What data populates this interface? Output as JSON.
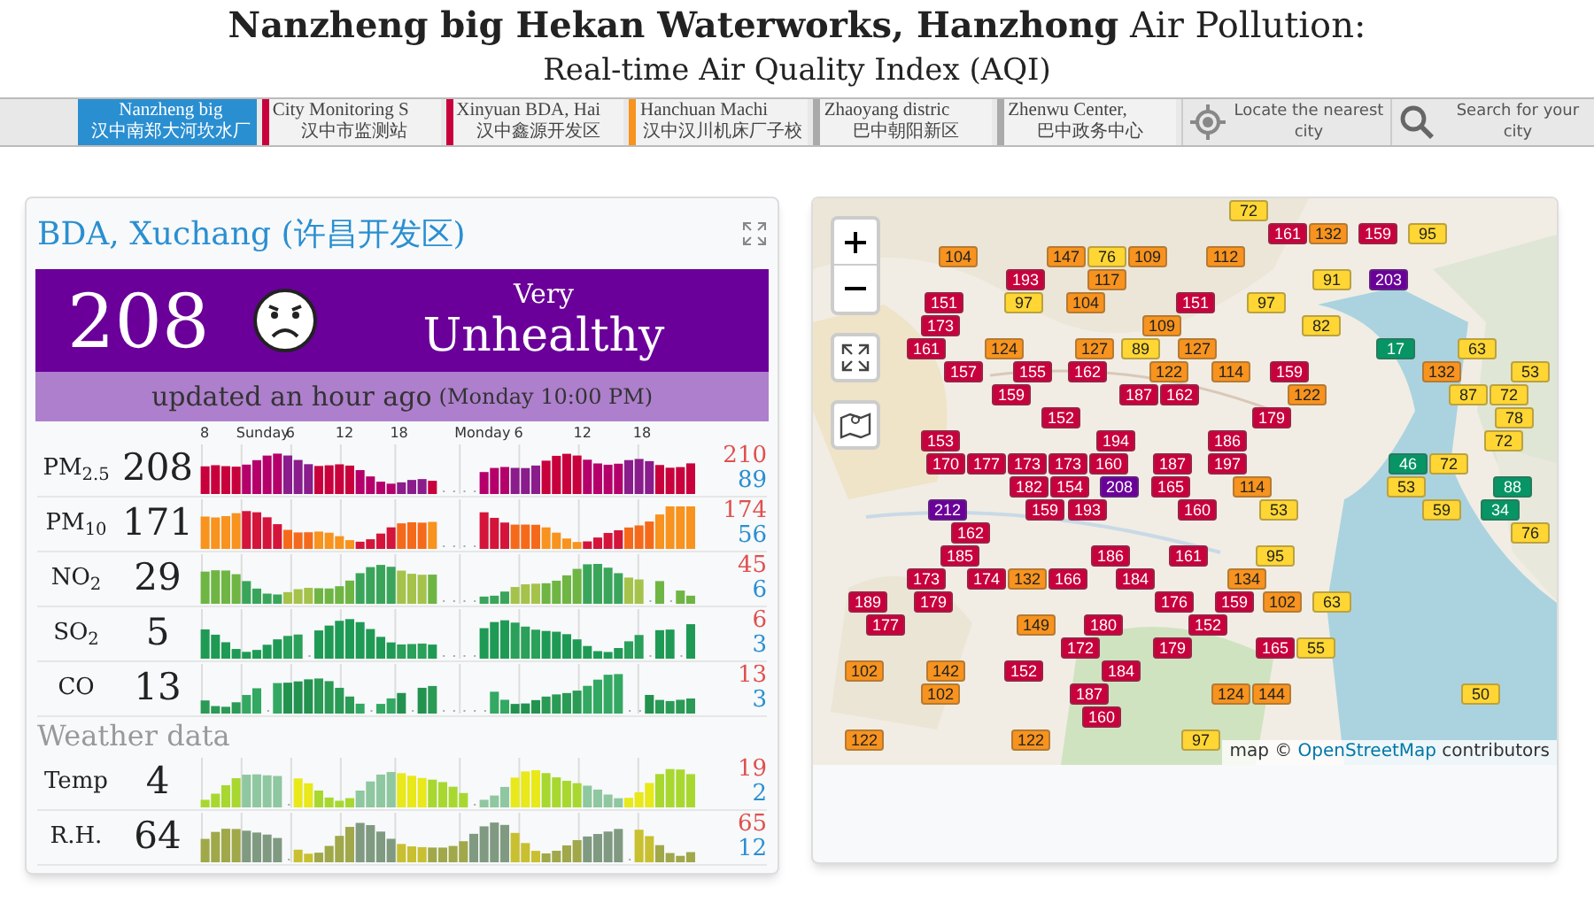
{
  "header": {
    "title": "**Nanzheng big Hekan Waterworks, Hanzhong** Air Pollution:",
    "subtitle": "Real-time Air Quality Index (AQI)"
  },
  "nav": {
    "tabs": [
      {
        "label": "Nanzheng big",
        "sublabel": "汉中南郑大河坎水厂",
        "color": "#2a8fd1",
        "selected": true
      },
      {
        "label": "City Monitoring S",
        "sublabel": "汉中市监测站",
        "color": "#c8003c",
        "selected": false
      },
      {
        "label": "Xinyuan BDA, Hai",
        "sublabel": "汉中鑫源开发区",
        "color": "#c8003c",
        "selected": false
      },
      {
        "label": "Hanchuan Machi",
        "sublabel": "汉中汉川机床厂子校",
        "color": "#f7931e",
        "selected": false
      },
      {
        "label": "Zhaoyang distric",
        "sublabel": "巴中朝阳新区",
        "color": "#aaaaaa",
        "selected": false
      },
      {
        "label": "Zhenwu Center,",
        "sublabel": "巴中政务中心",
        "color": "#aaaaaa",
        "selected": false
      }
    ],
    "locate": "Locate the nearest city",
    "search": "Search for your city"
  },
  "station": {
    "title": "BDA, Xuchang (许昌开发区)",
    "aqi": "208",
    "level_top": "Very",
    "level": "Unhealthy",
    "updated": "updated an hour ago",
    "updated_time": "(Monday 10:00 PM)",
    "axis_labels": [
      "8",
      "Sunday",
      "6",
      "12",
      "18",
      "Monday",
      "6",
      "12",
      "18"
    ],
    "pollutants": [
      {
        "name": "PM$_{2.5}$",
        "value": "208",
        "max": "210",
        "min": "89"
      },
      {
        "name": "PM$_{10}$",
        "value": "171",
        "max": "174",
        "min": "56"
      },
      {
        "name": "NO$_{2}$",
        "value": "29",
        "max": "45",
        "min": "6"
      },
      {
        "name": "SO$_{2}$",
        "value": "5",
        "max": "6",
        "min": "3"
      },
      {
        "name": "CO",
        "value": "13",
        "max": "13",
        "min": "3"
      }
    ],
    "weather_heading": "Weather data",
    "weather": [
      {
        "name": "Temp",
        "value": "4",
        "max": "19",
        "min": "2"
      },
      {
        "name": "R.H.",
        "value": "64",
        "max": "65",
        "min": "12"
      }
    ]
  },
  "map": {
    "attribution_prefix": "map ©",
    "attribution_link": "OpenStreetMap",
    "attribution_suffix": "contributors",
    "markers": [
      {
        "value": "72",
        "color": "#ffd633"
      },
      {
        "value": "161",
        "color": "#c8003c"
      },
      {
        "value": "132",
        "color": "#f7931e"
      },
      {
        "value": "159",
        "color": "#c8003c"
      },
      {
        "value": "95",
        "color": "#ffd633"
      },
      {
        "value": "104",
        "color": "#f7931e"
      },
      {
        "value": "147",
        "color": "#f7931e"
      },
      {
        "value": "76",
        "color": "#ffd633"
      },
      {
        "value": "109",
        "color": "#f7931e"
      },
      {
        "value": "112",
        "color": "#f7931e"
      },
      {
        "value": "193",
        "color": "#c8003c"
      },
      {
        "value": "117",
        "color": "#f7931e"
      },
      {
        "value": "91",
        "color": "#ffd633"
      },
      {
        "value": "203",
        "color": "#6a0099"
      },
      {
        "value": "151",
        "color": "#c8003c"
      },
      {
        "value": "97",
        "color": "#ffd633"
      },
      {
        "value": "104",
        "color": "#f7931e"
      },
      {
        "value": "151",
        "color": "#c8003c"
      },
      {
        "value": "97",
        "color": "#ffd633"
      },
      {
        "value": "173",
        "color": "#c8003c"
      },
      {
        "value": "109",
        "color": "#f7931e"
      },
      {
        "value": "82",
        "color": "#ffd633"
      },
      {
        "value": "161",
        "color": "#c8003c"
      },
      {
        "value": "124",
        "color": "#f7931e"
      },
      {
        "value": "127",
        "color": "#f7931e"
      },
      {
        "value": "89",
        "color": "#ffd633"
      },
      {
        "value": "127",
        "color": "#f7931e"
      },
      {
        "value": "17",
        "color": "#079565"
      },
      {
        "value": "63",
        "color": "#ffd633"
      },
      {
        "value": "157",
        "color": "#c8003c"
      },
      {
        "value": "155",
        "color": "#c8003c"
      },
      {
        "value": "162",
        "color": "#c8003c"
      },
      {
        "value": "122",
        "color": "#f7931e"
      },
      {
        "value": "114",
        "color": "#f7931e"
      },
      {
        "value": "159",
        "color": "#c8003c"
      },
      {
        "value": "132",
        "color": "#f7931e"
      },
      {
        "value": "53",
        "color": "#ffd633"
      },
      {
        "value": "159",
        "color": "#c8003c"
      },
      {
        "value": "187",
        "color": "#c8003c"
      },
      {
        "value": "162",
        "color": "#c8003c"
      },
      {
        "value": "122",
        "color": "#f7931e"
      },
      {
        "value": "87",
        "color": "#ffd633"
      },
      {
        "value": "72",
        "color": "#ffd633"
      },
      {
        "value": "152",
        "color": "#c8003c"
      },
      {
        "value": "179",
        "color": "#c8003c"
      },
      {
        "value": "78",
        "color": "#ffd633"
      },
      {
        "value": "153",
        "color": "#c8003c"
      },
      {
        "value": "194",
        "color": "#c8003c"
      },
      {
        "value": "186",
        "color": "#c8003c"
      },
      {
        "value": "72",
        "color": "#ffd633"
      },
      {
        "value": "170",
        "color": "#c8003c"
      },
      {
        "value": "177",
        "color": "#c8003c"
      },
      {
        "value": "173",
        "color": "#c8003c"
      },
      {
        "value": "173",
        "color": "#c8003c"
      },
      {
        "value": "160",
        "color": "#c8003c"
      },
      {
        "value": "187",
        "color": "#c8003c"
      },
      {
        "value": "197",
        "color": "#c8003c"
      },
      {
        "value": "46",
        "color": "#079565"
      },
      {
        "value": "72",
        "color": "#ffd633"
      },
      {
        "value": "182",
        "color": "#c8003c"
      },
      {
        "value": "154",
        "color": "#c8003c"
      },
      {
        "value": "208",
        "color": "#6a0099"
      },
      {
        "value": "165",
        "color": "#c8003c"
      },
      {
        "value": "114",
        "color": "#f7931e"
      },
      {
        "value": "53",
        "color": "#ffd633"
      },
      {
        "value": "88",
        "color": "#079565"
      },
      {
        "value": "212",
        "color": "#6a0099"
      },
      {
        "value": "159",
        "color": "#c8003c"
      },
      {
        "value": "193",
        "color": "#c8003c"
      },
      {
        "value": "160",
        "color": "#c8003c"
      },
      {
        "value": "53",
        "color": "#ffd633"
      },
      {
        "value": "59",
        "color": "#ffd633"
      },
      {
        "value": "34",
        "color": "#079565"
      },
      {
        "value": "162",
        "color": "#c8003c"
      },
      {
        "value": "76",
        "color": "#ffd633"
      },
      {
        "value": "185",
        "color": "#c8003c"
      },
      {
        "value": "186",
        "color": "#c8003c"
      },
      {
        "value": "161",
        "color": "#c8003c"
      },
      {
        "value": "95",
        "color": "#ffd633"
      },
      {
        "value": "173",
        "color": "#c8003c"
      },
      {
        "value": "174",
        "color": "#c8003c"
      },
      {
        "value": "132",
        "color": "#f7931e"
      },
      {
        "value": "166",
        "color": "#c8003c"
      },
      {
        "value": "184",
        "color": "#c8003c"
      },
      {
        "value": "134",
        "color": "#f7931e"
      },
      {
        "value": "189",
        "color": "#c8003c"
      },
      {
        "value": "179",
        "color": "#c8003c"
      },
      {
        "value": "176",
        "color": "#c8003c"
      },
      {
        "value": "159",
        "color": "#c8003c"
      },
      {
        "value": "102",
        "color": "#f7931e"
      },
      {
        "value": "63",
        "color": "#ffd633"
      },
      {
        "value": "177",
        "color": "#c8003c"
      },
      {
        "value": "149",
        "color": "#f7931e"
      },
      {
        "value": "180",
        "color": "#c8003c"
      },
      {
        "value": "152",
        "color": "#c8003c"
      },
      {
        "value": "172",
        "color": "#c8003c"
      },
      {
        "value": "179",
        "color": "#c8003c"
      },
      {
        "value": "165",
        "color": "#c8003c"
      },
      {
        "value": "55",
        "color": "#ffd633"
      },
      {
        "value": "102",
        "color": "#f7931e"
      },
      {
        "value": "142",
        "color": "#f7931e"
      },
      {
        "value": "152",
        "color": "#c8003c"
      },
      {
        "value": "184",
        "color": "#c8003c"
      },
      {
        "value": "102",
        "color": "#f7931e"
      },
      {
        "value": "187",
        "color": "#c8003c"
      },
      {
        "value": "124",
        "color": "#f7931e"
      },
      {
        "value": "144",
        "color": "#f7931e"
      },
      {
        "value": "50",
        "color": "#ffd633"
      },
      {
        "value": "160",
        "color": "#c8003c"
      },
      {
        "value": "122",
        "color": "#f7931e"
      },
      {
        "value": "122",
        "color": "#f7931e"
      },
      {
        "value": "97",
        "color": "#ffd633"
      }
    ]
  }
}
